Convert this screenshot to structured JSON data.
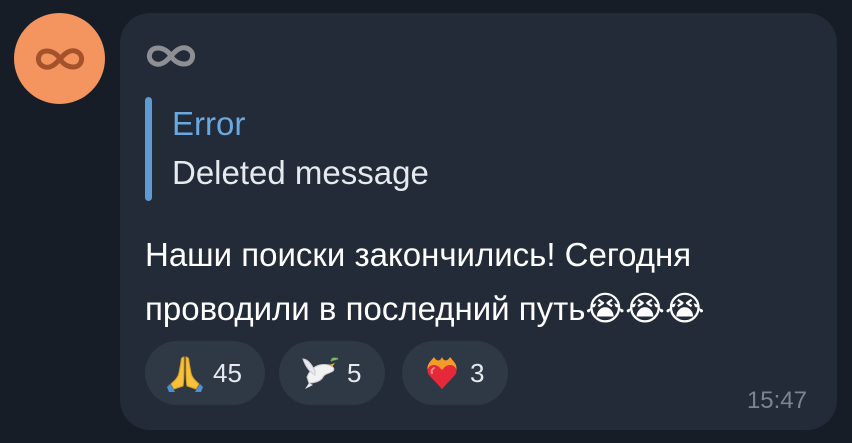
{
  "colors": {
    "background": "#161d27",
    "bubble": "#222b37",
    "avatar": "#f4955f",
    "reply_accent": "#5e9ad3",
    "reply_title": "#6aa8e2",
    "reaction_pill": "#2f3946",
    "timestamp": "#7a8593"
  },
  "avatar": {
    "icon": "infinity-icon"
  },
  "message": {
    "sender_icon": "infinity-icon",
    "reply": {
      "title": "Error",
      "text": "Deleted message"
    },
    "text_line1": "Наши поиски закончились! Сегодня",
    "text_line2": "проводили в последний путь",
    "trailing_emoji": [
      "😭",
      "😭",
      "😭"
    ],
    "reactions": [
      {
        "emoji": "🙏",
        "icon": "folded-hands-icon",
        "count": "45"
      },
      {
        "emoji": "🕊",
        "icon": "dove-icon",
        "count": "5"
      },
      {
        "emoji": "❤️‍🔥",
        "icon": "heart-on-fire-icon",
        "count": "3"
      }
    ],
    "time": "15:47"
  }
}
